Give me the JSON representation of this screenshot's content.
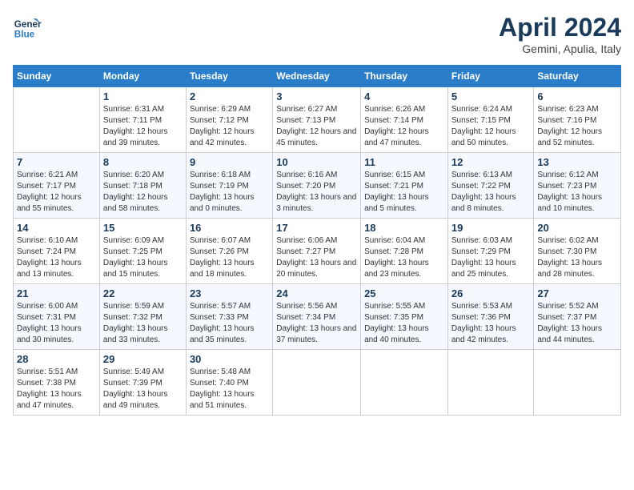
{
  "header": {
    "logo_line1": "General",
    "logo_line2": "Blue",
    "month": "April 2024",
    "location": "Gemini, Apulia, Italy"
  },
  "weekdays": [
    "Sunday",
    "Monday",
    "Tuesday",
    "Wednesday",
    "Thursday",
    "Friday",
    "Saturday"
  ],
  "weeks": [
    [
      {
        "day": "",
        "sunrise": "",
        "sunset": "",
        "daylight": ""
      },
      {
        "day": "1",
        "sunrise": "Sunrise: 6:31 AM",
        "sunset": "Sunset: 7:11 PM",
        "daylight": "Daylight: 12 hours and 39 minutes."
      },
      {
        "day": "2",
        "sunrise": "Sunrise: 6:29 AM",
        "sunset": "Sunset: 7:12 PM",
        "daylight": "Daylight: 12 hours and 42 minutes."
      },
      {
        "day": "3",
        "sunrise": "Sunrise: 6:27 AM",
        "sunset": "Sunset: 7:13 PM",
        "daylight": "Daylight: 12 hours and 45 minutes."
      },
      {
        "day": "4",
        "sunrise": "Sunrise: 6:26 AM",
        "sunset": "Sunset: 7:14 PM",
        "daylight": "Daylight: 12 hours and 47 minutes."
      },
      {
        "day": "5",
        "sunrise": "Sunrise: 6:24 AM",
        "sunset": "Sunset: 7:15 PM",
        "daylight": "Daylight: 12 hours and 50 minutes."
      },
      {
        "day": "6",
        "sunrise": "Sunrise: 6:23 AM",
        "sunset": "Sunset: 7:16 PM",
        "daylight": "Daylight: 12 hours and 52 minutes."
      }
    ],
    [
      {
        "day": "7",
        "sunrise": "Sunrise: 6:21 AM",
        "sunset": "Sunset: 7:17 PM",
        "daylight": "Daylight: 12 hours and 55 minutes."
      },
      {
        "day": "8",
        "sunrise": "Sunrise: 6:20 AM",
        "sunset": "Sunset: 7:18 PM",
        "daylight": "Daylight: 12 hours and 58 minutes."
      },
      {
        "day": "9",
        "sunrise": "Sunrise: 6:18 AM",
        "sunset": "Sunset: 7:19 PM",
        "daylight": "Daylight: 13 hours and 0 minutes."
      },
      {
        "day": "10",
        "sunrise": "Sunrise: 6:16 AM",
        "sunset": "Sunset: 7:20 PM",
        "daylight": "Daylight: 13 hours and 3 minutes."
      },
      {
        "day": "11",
        "sunrise": "Sunrise: 6:15 AM",
        "sunset": "Sunset: 7:21 PM",
        "daylight": "Daylight: 13 hours and 5 minutes."
      },
      {
        "day": "12",
        "sunrise": "Sunrise: 6:13 AM",
        "sunset": "Sunset: 7:22 PM",
        "daylight": "Daylight: 13 hours and 8 minutes."
      },
      {
        "day": "13",
        "sunrise": "Sunrise: 6:12 AM",
        "sunset": "Sunset: 7:23 PM",
        "daylight": "Daylight: 13 hours and 10 minutes."
      }
    ],
    [
      {
        "day": "14",
        "sunrise": "Sunrise: 6:10 AM",
        "sunset": "Sunset: 7:24 PM",
        "daylight": "Daylight: 13 hours and 13 minutes."
      },
      {
        "day": "15",
        "sunrise": "Sunrise: 6:09 AM",
        "sunset": "Sunset: 7:25 PM",
        "daylight": "Daylight: 13 hours and 15 minutes."
      },
      {
        "day": "16",
        "sunrise": "Sunrise: 6:07 AM",
        "sunset": "Sunset: 7:26 PM",
        "daylight": "Daylight: 13 hours and 18 minutes."
      },
      {
        "day": "17",
        "sunrise": "Sunrise: 6:06 AM",
        "sunset": "Sunset: 7:27 PM",
        "daylight": "Daylight: 13 hours and 20 minutes."
      },
      {
        "day": "18",
        "sunrise": "Sunrise: 6:04 AM",
        "sunset": "Sunset: 7:28 PM",
        "daylight": "Daylight: 13 hours and 23 minutes."
      },
      {
        "day": "19",
        "sunrise": "Sunrise: 6:03 AM",
        "sunset": "Sunset: 7:29 PM",
        "daylight": "Daylight: 13 hours and 25 minutes."
      },
      {
        "day": "20",
        "sunrise": "Sunrise: 6:02 AM",
        "sunset": "Sunset: 7:30 PM",
        "daylight": "Daylight: 13 hours and 28 minutes."
      }
    ],
    [
      {
        "day": "21",
        "sunrise": "Sunrise: 6:00 AM",
        "sunset": "Sunset: 7:31 PM",
        "daylight": "Daylight: 13 hours and 30 minutes."
      },
      {
        "day": "22",
        "sunrise": "Sunrise: 5:59 AM",
        "sunset": "Sunset: 7:32 PM",
        "daylight": "Daylight: 13 hours and 33 minutes."
      },
      {
        "day": "23",
        "sunrise": "Sunrise: 5:57 AM",
        "sunset": "Sunset: 7:33 PM",
        "daylight": "Daylight: 13 hours and 35 minutes."
      },
      {
        "day": "24",
        "sunrise": "Sunrise: 5:56 AM",
        "sunset": "Sunset: 7:34 PM",
        "daylight": "Daylight: 13 hours and 37 minutes."
      },
      {
        "day": "25",
        "sunrise": "Sunrise: 5:55 AM",
        "sunset": "Sunset: 7:35 PM",
        "daylight": "Daylight: 13 hours and 40 minutes."
      },
      {
        "day": "26",
        "sunrise": "Sunrise: 5:53 AM",
        "sunset": "Sunset: 7:36 PM",
        "daylight": "Daylight: 13 hours and 42 minutes."
      },
      {
        "day": "27",
        "sunrise": "Sunrise: 5:52 AM",
        "sunset": "Sunset: 7:37 PM",
        "daylight": "Daylight: 13 hours and 44 minutes."
      }
    ],
    [
      {
        "day": "28",
        "sunrise": "Sunrise: 5:51 AM",
        "sunset": "Sunset: 7:38 PM",
        "daylight": "Daylight: 13 hours and 47 minutes."
      },
      {
        "day": "29",
        "sunrise": "Sunrise: 5:49 AM",
        "sunset": "Sunset: 7:39 PM",
        "daylight": "Daylight: 13 hours and 49 minutes."
      },
      {
        "day": "30",
        "sunrise": "Sunrise: 5:48 AM",
        "sunset": "Sunset: 7:40 PM",
        "daylight": "Daylight: 13 hours and 51 minutes."
      },
      {
        "day": "",
        "sunrise": "",
        "sunset": "",
        "daylight": ""
      },
      {
        "day": "",
        "sunrise": "",
        "sunset": "",
        "daylight": ""
      },
      {
        "day": "",
        "sunrise": "",
        "sunset": "",
        "daylight": ""
      },
      {
        "day": "",
        "sunrise": "",
        "sunset": "",
        "daylight": ""
      }
    ]
  ]
}
